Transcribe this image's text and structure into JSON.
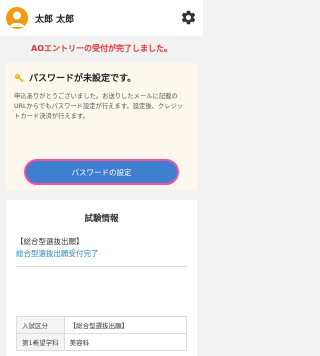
{
  "header": {
    "user_name": "太郎 太郎",
    "avatar_icon": "user-avatar-icon",
    "settings_icon": "gear-icon",
    "avatar_color": "#f39a12"
  },
  "notice": {
    "text": "AOエントリーの受付が完了しました。",
    "color": "#e03030"
  },
  "password_card": {
    "icon": "key-icon",
    "title": "パスワードが未設定です。",
    "message": "申込ありがとうございました。お送りしたメールに記載のURLからでもパスワード設定が行えます。設定後、クレジットカード決済が行えます。",
    "button_label": "パスワードの設定",
    "button_color": "#3f7fcf",
    "highlight_color": "#ff4d9b"
  },
  "exam_info": {
    "title": "試験情報",
    "category": "【総合型選抜出願】",
    "status": "総合型選抜出願受付完了",
    "rows": [
      {
        "label": "入試区分",
        "value": "【総合型選抜出願】"
      },
      {
        "label": "第1希望学科",
        "value": "美容科"
      }
    ]
  }
}
